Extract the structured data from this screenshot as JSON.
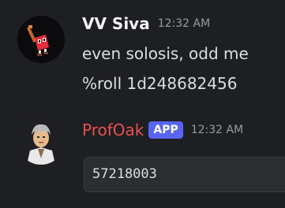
{
  "messages": [
    {
      "username": "VV Siva",
      "timestamp": "12:32 AM",
      "avatar_icon": "red-mushroom-character-avatar",
      "lines": [
        "even solosis, odd me",
        "%roll 1d248682456"
      ]
    },
    {
      "username": "ProfOak",
      "badge": "APP",
      "timestamp": "12:32 AM",
      "avatar_icon": "professor-oak-avatar",
      "code": "57218003"
    }
  ],
  "colors": {
    "background": "#1e1f22",
    "bot_name": "#e8514f",
    "app_badge": "#5865f2",
    "code_bg": "#2b2d31"
  }
}
